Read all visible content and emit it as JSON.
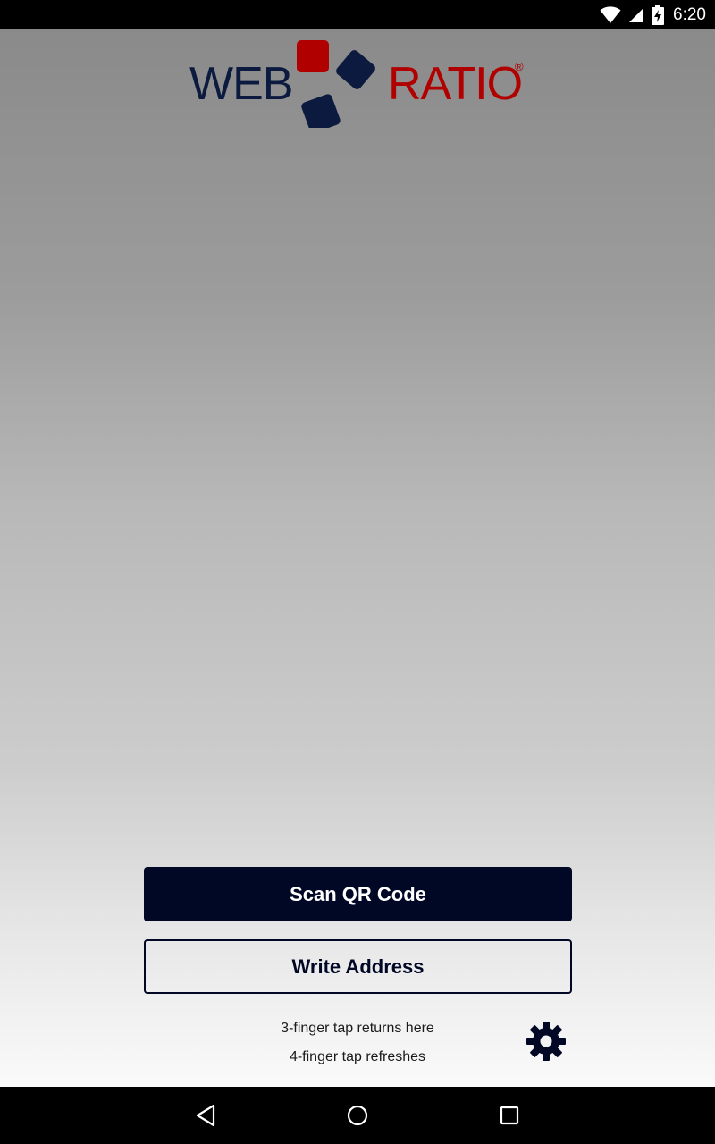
{
  "status_bar": {
    "time": "6:20",
    "icons": [
      "wifi-icon",
      "cell-signal-icon",
      "battery-charging-icon"
    ]
  },
  "logo": {
    "left_text": "WEB",
    "right_text": "RATIO",
    "registered_mark": "®",
    "colors": {
      "navy": "#0b1a3e",
      "red": "#b00000"
    }
  },
  "actions": {
    "scan_label": "Scan QR Code",
    "write_label": "Write Address"
  },
  "hints": {
    "line1": "3-finger tap returns here",
    "line2": "4-finger tap refreshes"
  },
  "settings": {
    "icon": "gear-icon"
  },
  "nav": {
    "icons": [
      "back-icon",
      "home-icon",
      "recents-icon"
    ]
  },
  "colors": {
    "primary": "#000826",
    "on_primary": "#ffffff"
  }
}
